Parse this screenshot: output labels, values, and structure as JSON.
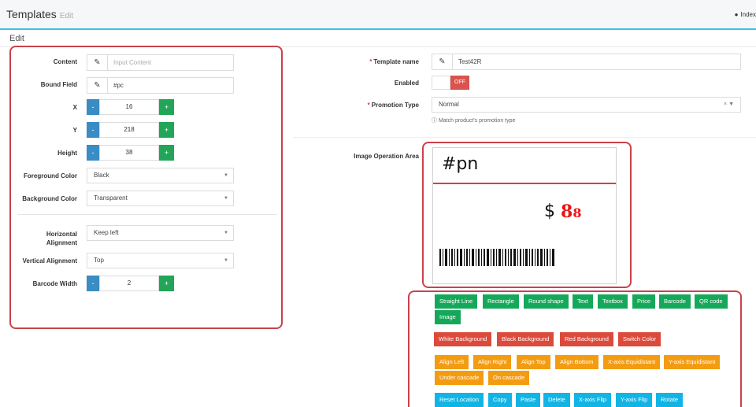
{
  "header": {
    "title": "Templates",
    "subtitle": "Edit",
    "index_label": "Index"
  },
  "subheader": {
    "label": "Edit"
  },
  "left_form": {
    "content": {
      "label": "Content",
      "placeholder": "Input Content"
    },
    "bound_field": {
      "label": "Bound Field",
      "value": "#pc"
    },
    "x": {
      "label": "X",
      "value": "16"
    },
    "y": {
      "label": "Y",
      "value": "218"
    },
    "height": {
      "label": "Height",
      "value": "38"
    },
    "foreground_color": {
      "label": "Foreground Color",
      "value": "Black"
    },
    "background_color": {
      "label": "Background Color",
      "value": "Transparent"
    },
    "horizontal_alignment": {
      "label_line1": "Horizontal",
      "label_line2": "Alignment",
      "value": "Keep left"
    },
    "vertical_alignment": {
      "label": "Vertical Alignment",
      "value": "Top"
    },
    "barcode_width": {
      "label": "Barcode Width",
      "value": "2"
    },
    "minus": "-",
    "plus": "+"
  },
  "right_form": {
    "template_name": {
      "label": "Template name",
      "value": "Test42R"
    },
    "enabled": {
      "label": "Enabled",
      "state_text": "OFF"
    },
    "promotion_type": {
      "label": "Promotion Type",
      "value": "Normal",
      "clear": "×",
      "help": "Match product's promotion type"
    },
    "image_area": {
      "label": "Image Operation Area"
    }
  },
  "canvas": {
    "name_text": "#pn",
    "currency": "$",
    "price_big": "8",
    "price_small": "8"
  },
  "toolbox": {
    "shapes": [
      "Straight Line",
      "Rectangle",
      "Round shape",
      "Text",
      "Textbox",
      "Price",
      "Barcode",
      "QR code",
      "Image"
    ],
    "backgrounds": [
      "White Background",
      "Black Background",
      "Red Background",
      "Switch Color"
    ],
    "alignment": [
      "Align Left",
      "Align Right",
      "Align Top",
      "Align Bottom",
      "X-axis Equidistant",
      "Y-axis Equidistant",
      "Under cascade",
      "On cascade"
    ],
    "actions": [
      "Reset Location",
      "Copy",
      "Paste",
      "Delete",
      "X-axis Flip",
      "Y-axis Flip",
      "Rotate"
    ]
  },
  "colors": {
    "accent": "#40c0e0",
    "highlight": "#c9424a",
    "green": "#16a85a",
    "red": "#dc4a3c",
    "orange": "#f39c12",
    "cyan": "#11b5e5",
    "blue": "#3a8cc4"
  }
}
